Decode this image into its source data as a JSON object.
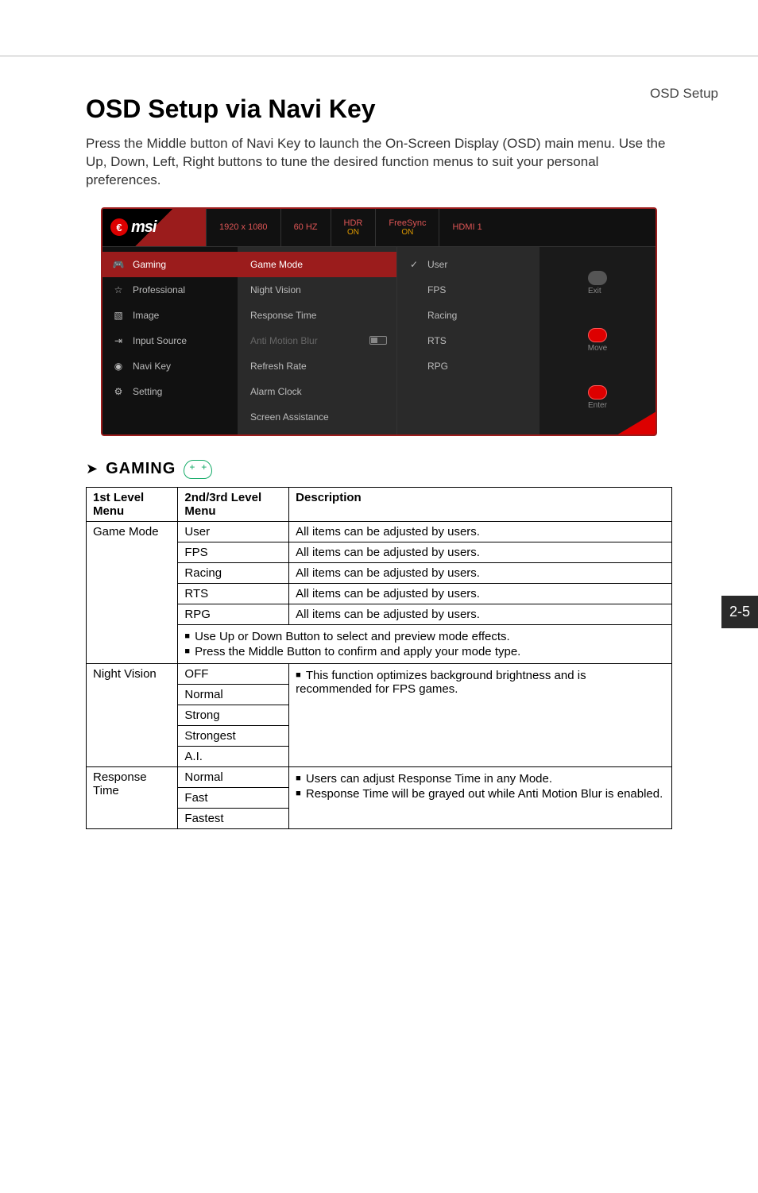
{
  "header": {
    "section": "OSD Setup"
  },
  "page_number_side": "2-5",
  "title": "OSD Setup via Navi Key",
  "intro": "Press the Middle button of Navi Key to launch the On-Screen Display (OSD) main menu. Use the Up, Down, Left, Right buttons to tune the desired function menus to suit your personal preferences.",
  "osd": {
    "logo": "msi",
    "logo_badge": "€",
    "stats": {
      "resolution": "1920 x 1080",
      "refresh": "60 HZ",
      "hdr_label": "HDR",
      "hdr_status": "ON",
      "freesync_label": "FreeSync",
      "freesync_status": "ON",
      "input": "HDMI 1"
    },
    "menu1": [
      {
        "label": "Gaming",
        "active": true
      },
      {
        "label": "Professional"
      },
      {
        "label": "Image"
      },
      {
        "label": "Input Source"
      },
      {
        "label": "Navi Key"
      },
      {
        "label": "Setting"
      }
    ],
    "menu2": [
      {
        "label": "Game Mode",
        "active": true
      },
      {
        "label": "Night Vision"
      },
      {
        "label": "Response Time"
      },
      {
        "label": "Anti Motion Blur",
        "disabled": true,
        "toggle": true
      },
      {
        "label": "Refresh Rate"
      },
      {
        "label": "Alarm Clock"
      },
      {
        "label": "Screen Assistance"
      }
    ],
    "menu3": [
      {
        "label": "User",
        "checked": true
      },
      {
        "label": "FPS"
      },
      {
        "label": "Racing"
      },
      {
        "label": "RTS"
      },
      {
        "label": "RPG"
      }
    ],
    "side": {
      "exit": "Exit",
      "move": "Move",
      "enter": "Enter"
    }
  },
  "section_heading": "GAMING",
  "table": {
    "headers": {
      "c1": "1st Level Menu",
      "c2": "2nd/3rd Level Menu",
      "c3": "Description"
    },
    "game_mode": {
      "name": "Game Mode",
      "rows": [
        {
          "opt": "User",
          "desc": "All items can be adjusted by users."
        },
        {
          "opt": "FPS",
          "desc": "All items can be adjusted by users."
        },
        {
          "opt": "Racing",
          "desc": "All items can be adjusted by users."
        },
        {
          "opt": "RTS",
          "desc": "All items can be adjusted by users."
        },
        {
          "opt": "RPG",
          "desc": "All items can be adjusted by users."
        }
      ],
      "notes": [
        "Use Up or Down Button to select and preview mode effects.",
        "Press the Middle Button to confirm and apply your mode type."
      ]
    },
    "night_vision": {
      "name": "Night Vision",
      "opts": [
        "OFF",
        "Normal",
        "Strong",
        "Strongest",
        "A.I."
      ],
      "desc": [
        "This function optimizes background brightness and is recommended for FPS games."
      ]
    },
    "response_time": {
      "name": "Response Time",
      "opts": [
        "Normal",
        "Fast",
        "Fastest"
      ],
      "desc": [
        "Users can adjust Response Time in any Mode.",
        "Response Time will be grayed out while Anti Motion Blur is enabled."
      ]
    }
  }
}
